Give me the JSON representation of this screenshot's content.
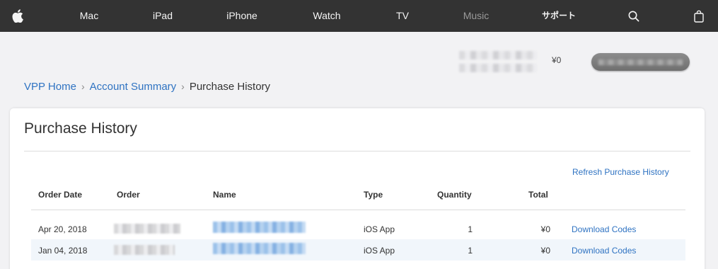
{
  "nav": {
    "items": [
      {
        "label": "Mac"
      },
      {
        "label": "iPad"
      },
      {
        "label": "iPhone"
      },
      {
        "label": "Watch"
      },
      {
        "label": "TV"
      },
      {
        "label": "Music"
      },
      {
        "label": "サポート"
      }
    ],
    "icons": [
      "apple-logo-icon",
      "search-icon",
      "shopping-bag-icon"
    ]
  },
  "account": {
    "balance": "¥0"
  },
  "breadcrumb": {
    "home": "VPP Home",
    "summary": "Account Summary",
    "current": "Purchase History",
    "separator": "›"
  },
  "page": {
    "title": "Purchase History",
    "refresh_label": "Refresh Purchase History"
  },
  "table": {
    "columns": [
      "Order Date",
      "Order",
      "Name",
      "Type",
      "Quantity",
      "Total"
    ],
    "rows": [
      {
        "date": "Apr 20, 2018",
        "type": "iOS App",
        "quantity": "1",
        "total": "¥0",
        "action": "Download Codes"
      },
      {
        "date": "Jan 04, 2018",
        "type": "iOS App",
        "quantity": "1",
        "total": "¥0",
        "action": "Download Codes"
      }
    ]
  },
  "colors": {
    "nav_bg": "#333333",
    "link": "#2f73c2",
    "page_bg": "#f2f2f4",
    "alt_row": "#f1f6fb"
  }
}
